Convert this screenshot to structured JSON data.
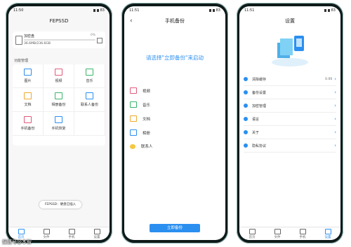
{
  "status": {
    "time_a": "11:50",
    "time_b": "11:51",
    "battery": "83"
  },
  "phone1": {
    "title": "FEPSSD",
    "storage_name": "加密盘",
    "storage_percent": "0%",
    "storage_used": "36.6MB/236.6GB",
    "section": "功能管理",
    "grid": [
      "图片",
      "视频",
      "音乐",
      "文档",
      "相册备份",
      "联系人备份",
      "手机备份",
      "手机恢复"
    ],
    "toast": "FEPSSD：硬盘已插入"
  },
  "phone2": {
    "title": "手机备份",
    "prompt": "请选择\"立即备份\"来启动",
    "items": [
      "视频",
      "音乐",
      "文档",
      "相册",
      "联系人"
    ],
    "button": "立即备份"
  },
  "phone3": {
    "title": "设置",
    "items": [
      {
        "label": "清除缓存",
        "value": "0.00"
      },
      {
        "label": "备份设置",
        "value": ""
      },
      {
        "label": "加密管理",
        "value": ""
      },
      {
        "label": "语言",
        "value": ""
      },
      {
        "label": "关于",
        "value": ""
      },
      {
        "label": "隐私协议",
        "value": ""
      }
    ]
  },
  "nav": [
    "首页",
    "文件",
    "手机",
    "设置"
  ],
  "watermark": "搜狐号@本智",
  "colors": {
    "accent": "#2b8ff0"
  }
}
